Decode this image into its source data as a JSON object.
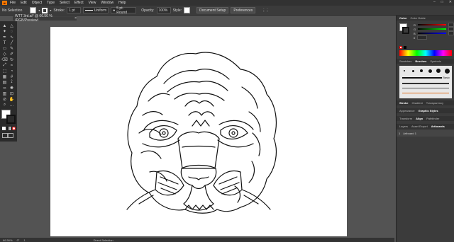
{
  "menubar": {
    "logo": "Ai",
    "menus": [
      "File",
      "Edit",
      "Object",
      "Type",
      "Select",
      "Effect",
      "View",
      "Window",
      "Help"
    ],
    "window_controls": [
      "–",
      "□",
      "✕"
    ]
  },
  "control_bar": {
    "selection_label": "No Selection",
    "stroke_label": "Stroke:",
    "stroke_weight": "1 pt",
    "uniform_label": "Uniform",
    "brush_label": "5 pt. Round",
    "opacity_label": "Opacity:",
    "opacity_value": "100%",
    "style_label": "Style:",
    "document_setup_label": "Document Setup",
    "preferences_label": "Preferences"
  },
  "document_tab": {
    "title": "WTT 3rd.ai* @ 66.56 % (RGB/Preview)",
    "close": "×"
  },
  "toolbar": {
    "tools": [
      "selection-tool",
      "direct-selection-tool",
      "magic-wand-tool",
      "lasso-tool",
      "pen-tool",
      "curvature-tool",
      "type-tool",
      "line-tool",
      "rectangle-tool",
      "paintbrush-tool",
      "shaper-tool",
      "pencil-tool",
      "eraser-tool",
      "rotate-tool",
      "scale-tool",
      "warp-tool",
      "free-transform-tool",
      "shape-builder-tool",
      "perspective-tool",
      "mesh-tool",
      "gradient-tool",
      "eyedropper-tool",
      "blend-tool",
      "symbol-sprayer-tool",
      "graph-tool",
      "artboard-tool",
      "slice-tool",
      "hand-tool",
      "zoom-tool",
      "more-tools"
    ]
  },
  "statusbar": {
    "zoom": "66.56%",
    "angle": "0°",
    "artboard_nav": "1",
    "tool_name": "Direct Selection"
  },
  "color_panel": {
    "tabs": [
      "Color",
      "Color Guide"
    ],
    "channels": [
      {
        "label": "R",
        "color": "#ff0000"
      },
      {
        "label": "G",
        "color": "#00ff00"
      },
      {
        "label": "B",
        "color": "#0000ff"
      }
    ],
    "hex_label": "#"
  },
  "brushes_panel": {
    "tabs": [
      "Swatches",
      "Brushes",
      "Symbols"
    ],
    "basic_label": "Basic"
  },
  "stroke_panel": {
    "tabs": [
      "Stroke",
      "Gradient",
      "Transparency"
    ]
  },
  "appearance_panel": {
    "tabs": [
      "Appearance",
      "Graphic Styles"
    ]
  },
  "transform_panel": {
    "tabs": [
      "Transform",
      "Align",
      "Pathfinder"
    ]
  },
  "layers_panel": {
    "tabs": [
      "Layers",
      "Asset Export",
      "Artboards"
    ],
    "rows": [
      {
        "index": "1",
        "name": "Artboard 1"
      }
    ]
  },
  "colors": {
    "accent": "#ff7c00",
    "ui_dark": "#323232",
    "ui_mid": "#3b3b3b",
    "canvas": "#535353"
  }
}
